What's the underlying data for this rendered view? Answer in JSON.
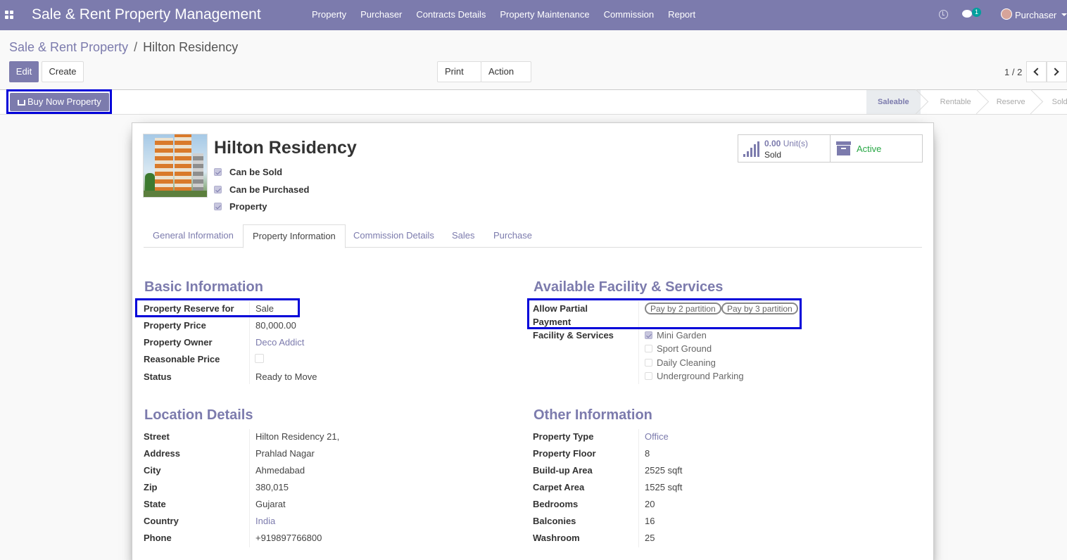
{
  "app": {
    "title": "Sale & Rent Property Management",
    "menu": [
      "Property",
      "Purchaser",
      "Contracts Details",
      "Property Maintenance",
      "Commission",
      "Report"
    ],
    "chat_count": "1",
    "user": "Purchaser"
  },
  "breadcrumb": {
    "parent": "Sale & Rent Property",
    "separator": "/",
    "current": "Hilton Residency"
  },
  "toolbar": {
    "edit": "Edit",
    "create": "Create",
    "print": "Print",
    "action": "Action",
    "pager": "1 / 2"
  },
  "header": {
    "buy_button": "Buy Now Property",
    "stages": [
      "Saleable",
      "Rentable",
      "Reserve",
      "Sold"
    ],
    "active_stage": "Saleable"
  },
  "record": {
    "name": "Hilton Residency",
    "flags": [
      {
        "label": "Can be Sold",
        "checked": true
      },
      {
        "label": "Can be Purchased",
        "checked": true
      },
      {
        "label": "Property",
        "checked": true
      }
    ],
    "smart": {
      "sold_value": "0.00",
      "sold_unit": "Unit(s)",
      "sold_label": "Sold",
      "active_label": "Active"
    }
  },
  "tabs": [
    "General Information",
    "Property Information",
    "Commission Details",
    "Sales",
    "Purchase"
  ],
  "active_tab": "Property Information",
  "basic": {
    "title": "Basic Information",
    "reserve_label": "Property Reserve for",
    "reserve_value": "Sale",
    "price_label": "Property Price",
    "price_value": "80,000.00",
    "owner_label": "Property Owner",
    "owner_value": "Deco Addict",
    "reasonable_label": "Reasonable Price",
    "reasonable_checked": false,
    "status_label": "Status",
    "status_value": "Ready to Move"
  },
  "facility": {
    "title": "Available Facility & Services",
    "partial_label_1": "Allow Partial",
    "partial_label_2": "Payment",
    "partial_tags": [
      "Pay by 2 partition",
      "Pay by 3 partition"
    ],
    "services_label": "Facility & Services",
    "services": [
      {
        "label": "Mini Garden",
        "checked": true
      },
      {
        "label": "Sport Ground",
        "checked": false
      },
      {
        "label": "Daily Cleaning",
        "checked": false
      },
      {
        "label": "Underground Parking",
        "checked": false
      }
    ]
  },
  "location": {
    "title": "Location Details",
    "rows": [
      {
        "label": "Street",
        "value": "Hilton Residency 21,"
      },
      {
        "label": "Address",
        "value": "Prahlad Nagar"
      },
      {
        "label": "City",
        "value": "Ahmedabad"
      },
      {
        "label": "Zip",
        "value": "380,015"
      },
      {
        "label": "State",
        "value": "Gujarat"
      },
      {
        "label": "Country",
        "value": "India"
      },
      {
        "label": "Phone",
        "value": "+919897766800"
      }
    ]
  },
  "other": {
    "title": "Other Information",
    "rows": [
      {
        "label": "Property Type",
        "value": "Office"
      },
      {
        "label": "Property Floor",
        "value": "8"
      },
      {
        "label": "Build-up Area",
        "value": "2525 sqft"
      },
      {
        "label": "Carpet Area",
        "value": "1525 sqft"
      },
      {
        "label": "Bedrooms",
        "value": "20"
      },
      {
        "label": "Balconies",
        "value": "16"
      },
      {
        "label": "Washroom",
        "value": "25"
      }
    ]
  },
  "colors": {
    "brand": "#7c7bad",
    "highlight": "#0000d9",
    "active_green": "#28a745"
  }
}
